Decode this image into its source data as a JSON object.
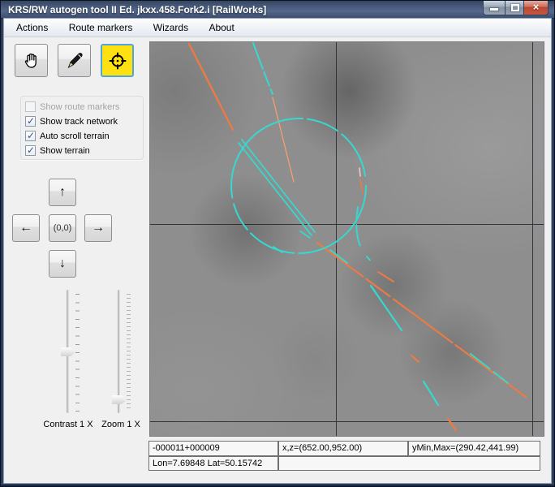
{
  "window": {
    "title": "KRS/RW autogen tool II Ed. jkxx.458.Fork2.i [RailWorks]",
    "close_glyph": "×"
  },
  "menu": {
    "items": [
      {
        "label": "Actions"
      },
      {
        "label": "Route markers"
      },
      {
        "label": "Wizards"
      },
      {
        "label": "About"
      }
    ]
  },
  "toolbar": {
    "tools": [
      {
        "name": "pan",
        "icon": "hand-icon",
        "selected": false
      },
      {
        "name": "edit",
        "icon": "pencil-icon",
        "selected": false
      },
      {
        "name": "center-target",
        "icon": "crosshair-icon",
        "selected": true
      }
    ]
  },
  "left_panel": {
    "checkboxes": [
      {
        "label": "Show route markers",
        "checked": false,
        "disabled": true
      },
      {
        "label": "Show track network",
        "checked": true,
        "disabled": false
      },
      {
        "label": "Auto scroll terrain",
        "checked": true,
        "disabled": false
      },
      {
        "label": "Show terrain",
        "checked": true,
        "disabled": false
      }
    ],
    "nav": {
      "up": "↑",
      "left": "←",
      "center": "(0,0)",
      "right": "→",
      "down": "↓"
    },
    "sliders": [
      {
        "label": "Contrast 1 X",
        "value_percent": 51
      },
      {
        "label": "Zoom 1 X",
        "value_percent": 90
      }
    ]
  },
  "map": {
    "colors": {
      "background": "#8e8e8e",
      "grid": "#26262a",
      "track_cyan": "#36d8cf",
      "track_orange": "#ec7a45"
    }
  },
  "status_bar": {
    "row1": [
      "-000011+000009",
      "x,z=(652.00,952.00)",
      "yMin,Max=(290.42,441.99)"
    ],
    "row2": [
      "Lon=7.69848 Lat=50.15742",
      ""
    ]
  }
}
